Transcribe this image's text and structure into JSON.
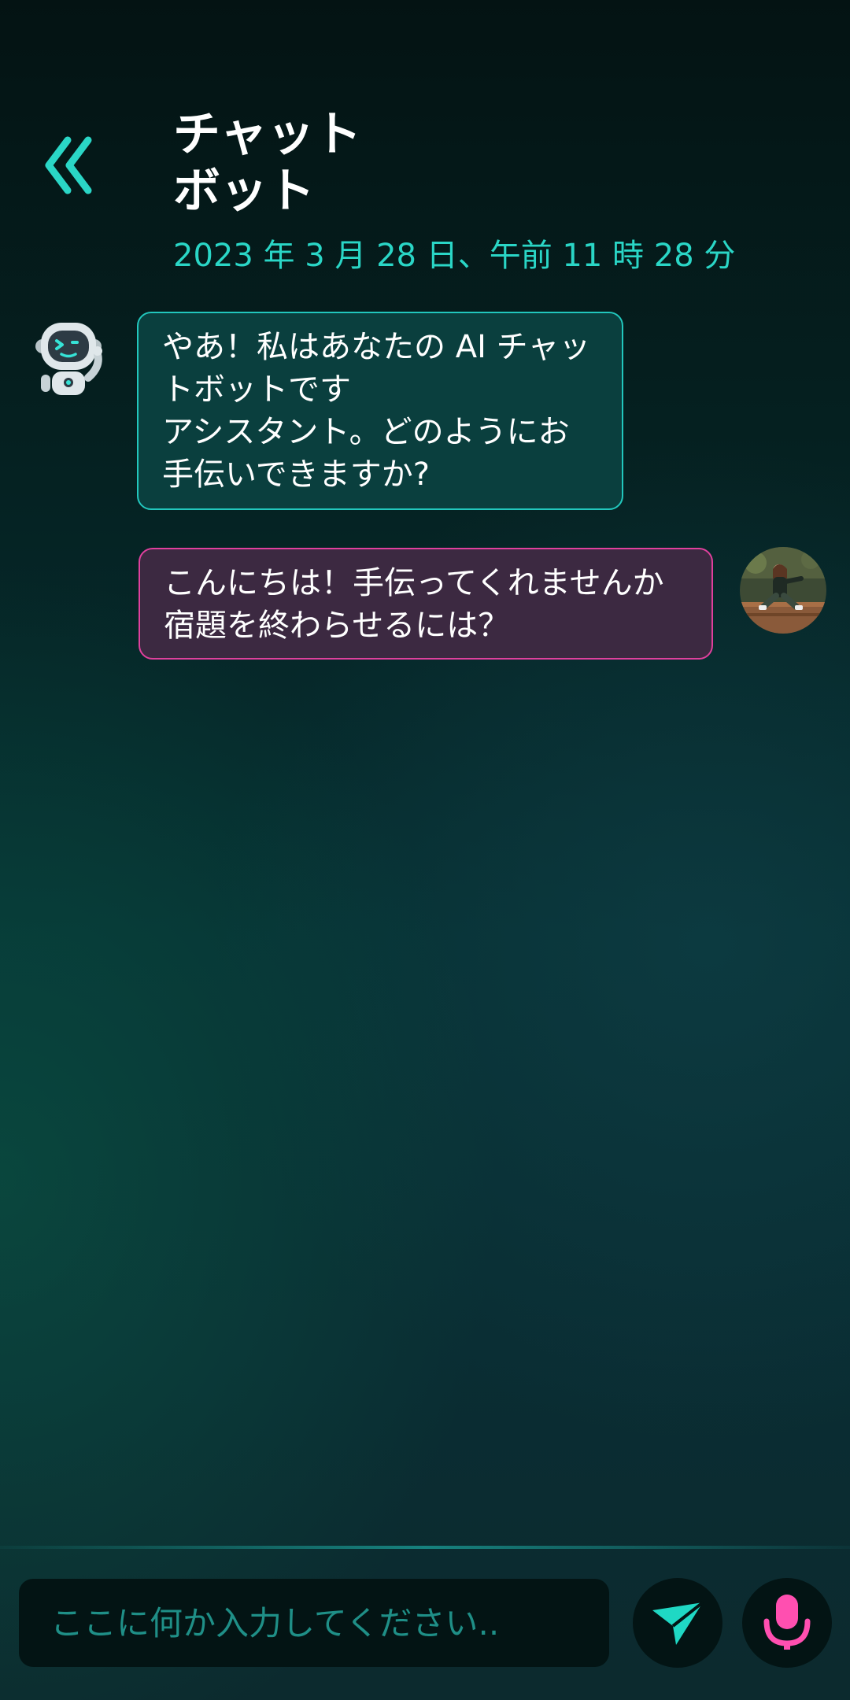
{
  "header": {
    "title_line1": "チャット",
    "title_line2": "ボット",
    "timestamp": "2023 年 3 月 28 日、午前 11 時 28 分",
    "back_icon": "double-chevron-left-icon"
  },
  "messages": [
    {
      "sender": "bot",
      "avatar": "robot-avatar",
      "lines": [
        "やあ！私はあなたの AI チャッ",
        "トボットです",
        "アシスタント。どのようにお",
        "手伝いできますか?"
      ]
    },
    {
      "sender": "user",
      "avatar": "user-photo-avatar",
      "lines": [
        "こんにちは！手伝ってくれませんか",
        "宿題を終わらせるには？"
      ]
    }
  ],
  "composer": {
    "placeholder": "ここに何か入力してください..",
    "send_icon": "send-icon",
    "mic_icon": "microphone-icon"
  },
  "colors": {
    "accent": "#2ad6c6",
    "bot_bubble_bg": "#0a3f3e",
    "bot_bubble_border": "#22c7bd",
    "user_bubble_bg": "#3c2941",
    "user_bubble_border": "#e0409d",
    "mic": "#ff4fb0",
    "send": "#1fd8c4"
  }
}
